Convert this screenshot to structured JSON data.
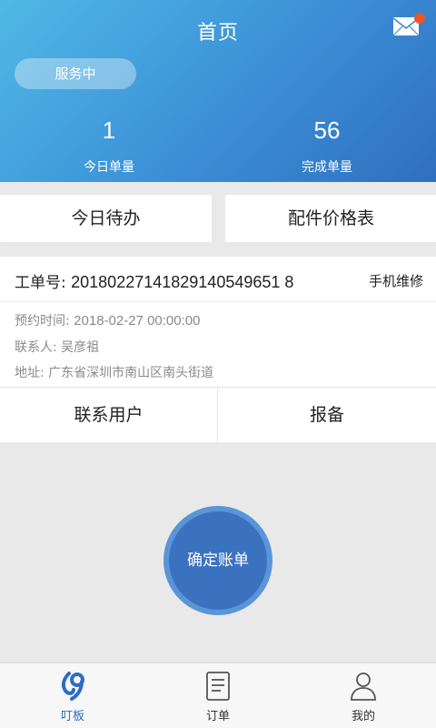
{
  "header": {
    "title": "首页",
    "status_label": "服务中",
    "stats": [
      {
        "value": "1",
        "label": "今日单量"
      },
      {
        "value": "56",
        "label": "完成单量"
      }
    ],
    "mail_icon": "mail-icon",
    "badge_color": "#e8572b"
  },
  "quick_actions": {
    "todo": "今日待办",
    "price_list": "配件价格表"
  },
  "order": {
    "number_label": "工单号:",
    "number": "20180227141829140549651 8",
    "type": "手机维修",
    "appointment_label": "预约时间:",
    "appointment": "2018-02-27 00:00:00",
    "contact_label": "联系人:",
    "contact": "吴彦祖",
    "address_label": "地址:",
    "address": "广东省深圳市南山区南头街道",
    "contact_user_btn": "联系用户",
    "report_btn": "报备"
  },
  "confirm_bill": "确定账单",
  "tabbar": {
    "items": [
      {
        "label": "叮板",
        "icon": "dingban-icon",
        "active": true
      },
      {
        "label": "订单",
        "icon": "order-doc-icon",
        "active": false
      },
      {
        "label": "我的",
        "icon": "user-icon",
        "active": false
      }
    ]
  },
  "colors": {
    "header_gradient_start": "#4fb9e6",
    "header_gradient_end": "#2f6fbf",
    "accent": "#3b72c0",
    "active_tab": "#2e6cc0"
  }
}
